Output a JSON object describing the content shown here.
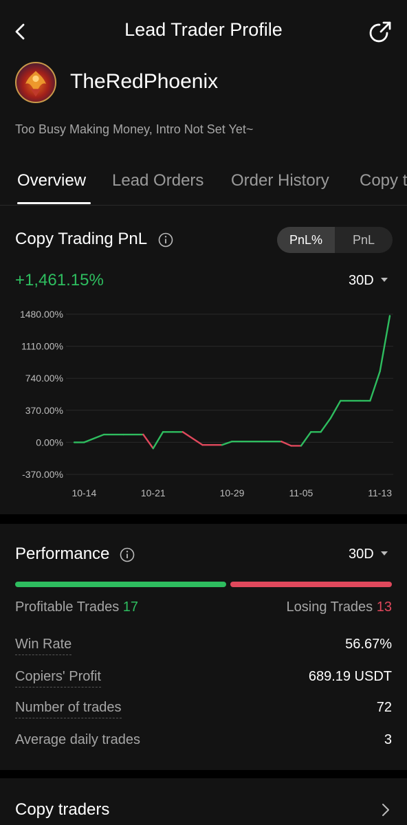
{
  "header": {
    "title": "Lead Trader Profile"
  },
  "profile": {
    "username": "TheRedPhoenix",
    "intro": "Too Busy Making Money, Intro Not Set Yet~"
  },
  "tabs": [
    {
      "label": "Overview",
      "active": true
    },
    {
      "label": "Lead Orders",
      "active": false
    },
    {
      "label": "Order History",
      "active": false
    },
    {
      "label": "Copy t",
      "active": false
    }
  ],
  "pnl": {
    "title": "Copy Trading PnL",
    "toggle": [
      "PnL%",
      "PnL"
    ],
    "value": "+1,461.15%",
    "period": "30D"
  },
  "chart_data": {
    "type": "line",
    "x_tick_labels": [
      "10-14",
      "10-21",
      "10-29",
      "11-05",
      "11-13"
    ],
    "y_tick_labels": [
      "1480.00%",
      "1110.00%",
      "740.00%",
      "370.00%",
      "0.00%",
      "-370.00%"
    ],
    "ylim": [
      -370,
      1480
    ],
    "x_start": "10-13",
    "x_end": "11-14",
    "x": [
      "10-13",
      "10-14",
      "10-16",
      "10-18",
      "10-20",
      "10-21",
      "10-22",
      "10-23",
      "10-24",
      "10-26",
      "10-28",
      "10-29",
      "10-30",
      "11-01",
      "11-03",
      "11-04",
      "11-05",
      "11-06",
      "11-07",
      "11-08",
      "11-09",
      "11-11",
      "11-12",
      "11-13",
      "11-14"
    ],
    "y": [
      0,
      0,
      90,
      90,
      90,
      -70,
      120,
      120,
      120,
      -30,
      -30,
      10,
      10,
      10,
      10,
      -40,
      -40,
      120,
      120,
      280,
      480,
      480,
      480,
      820,
      1461
    ],
    "colors": {
      "up": "#2ebd5f",
      "down": "#e0485c",
      "grid": "#2a2a2a",
      "tick": "#bdbdbd"
    }
  },
  "performance": {
    "title": "Performance",
    "period": "30D",
    "profitable_label": "Profitable Trades",
    "profitable_count": "17",
    "losing_label": "Losing Trades",
    "losing_count": "13",
    "profit_ratio": 0.5667,
    "stats": [
      {
        "label": "Win Rate",
        "value": "56.67%"
      },
      {
        "label": "Copiers' Profit",
        "value": "689.19 USDT"
      },
      {
        "label": "Number of trades",
        "value": "72"
      },
      {
        "label": "Average daily trades",
        "value": "3"
      }
    ]
  },
  "copy_traders": {
    "label": "Copy traders"
  },
  "icons": {
    "back": "chevron-left-icon",
    "share": "share-icon",
    "info": "info-icon",
    "dropdown": "caret-down-icon",
    "next": "chevron-right-icon"
  },
  "colors": {
    "green": "#2ebd5f",
    "red": "#e0485c",
    "panel": "#131313",
    "background": "#000000"
  }
}
